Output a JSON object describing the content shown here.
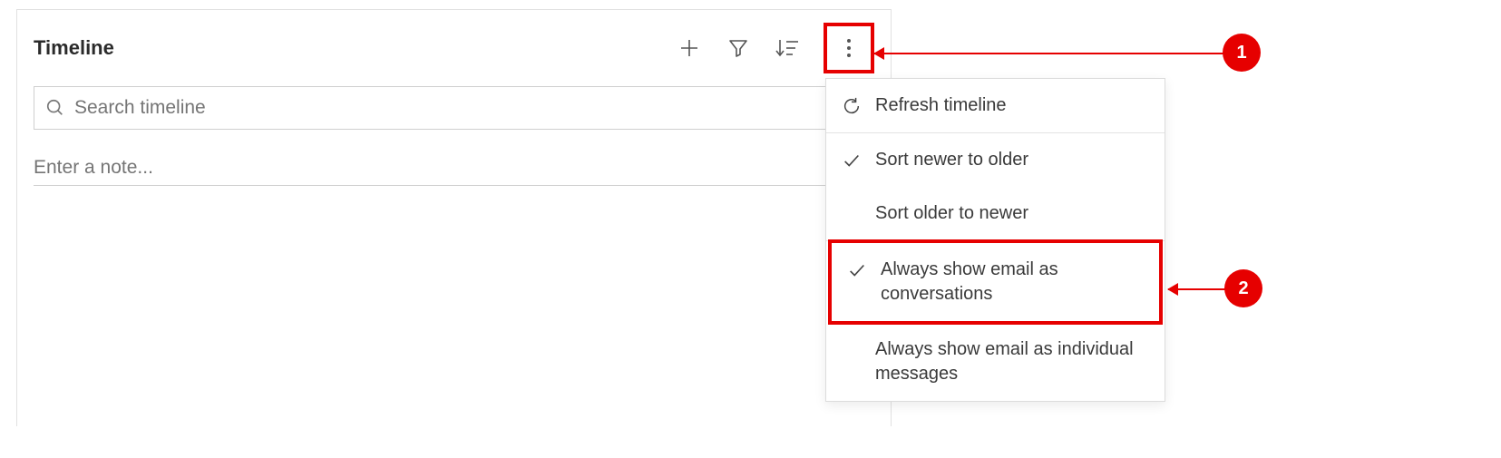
{
  "timeline": {
    "title": "Timeline",
    "search_placeholder": "Search timeline",
    "note_placeholder": "Enter a note..."
  },
  "toolbar": {
    "add": "plus-icon",
    "filter": "filter-icon",
    "sort": "sort-icon",
    "more": "more-vertical-icon"
  },
  "menu": {
    "items": [
      {
        "label": "Refresh timeline",
        "icon": "refresh",
        "checked": false
      },
      {
        "label": "Sort newer to older",
        "icon": "check",
        "checked": true
      },
      {
        "label": "Sort older to newer",
        "icon": "",
        "checked": false
      },
      {
        "label": "Always show email as conversations",
        "icon": "check",
        "checked": true
      },
      {
        "label": "Always show email as individual messages",
        "icon": "",
        "checked": false
      }
    ]
  },
  "callouts": {
    "c1": "1",
    "c2": "2"
  },
  "colors": {
    "highlight": "#e60000"
  }
}
